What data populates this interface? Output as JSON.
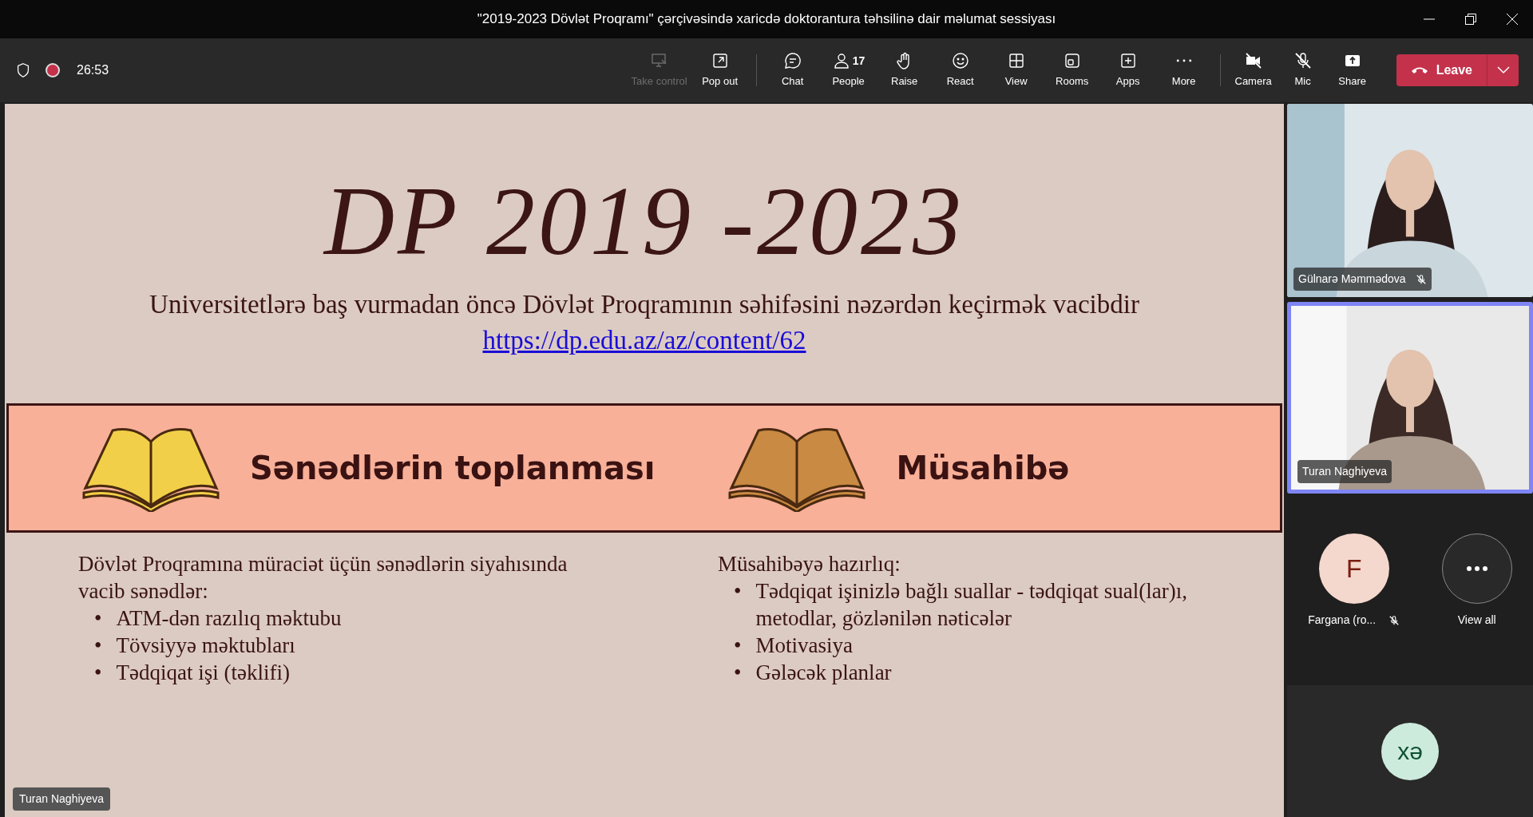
{
  "window": {
    "title": "\"2019-2023 Dövlət Proqramı\" çərçivəsində xaricdə doktorantura təhsilinə dair məlumat sessiyası"
  },
  "toolbar": {
    "recording": true,
    "timer": "26:53",
    "buttons": [
      {
        "label": "Take control",
        "disabled": true
      },
      {
        "label": "Pop out",
        "disabled": false
      },
      {
        "label": "Chat",
        "disabled": false
      },
      {
        "label": "People",
        "disabled": false,
        "count": "17"
      },
      {
        "label": "Raise",
        "disabled": false
      },
      {
        "label": "React",
        "disabled": false
      },
      {
        "label": "View",
        "disabled": false
      },
      {
        "label": "Rooms",
        "disabled": false
      },
      {
        "label": "Apps",
        "disabled": false
      },
      {
        "label": "More",
        "disabled": false
      }
    ],
    "devices": [
      {
        "label": "Camera",
        "on": false
      },
      {
        "label": "Mic",
        "on": false
      },
      {
        "label": "Share",
        "on": true
      }
    ],
    "leave": {
      "label": "Leave"
    }
  },
  "slide": {
    "title": "DP 2019 -2023",
    "subtitle": "Universitetlərə baş vurmadan öncə Dövlət Proqramının səhifəsini nəzərdən keçirmək vacibdir",
    "link": "https://dp.edu.az/az/content/62",
    "sections": [
      {
        "heading": "Sənədlərin toplanması",
        "marker": "•",
        "intro": "Dövlət Proqramına müraciət üçün sənədlərin siyahısında vacib sənədlər:",
        "bullets": [
          "ATM-dən razılıq məktubu",
          "Tövsiyyə məktubları",
          "Tədqiqat işi (təklifi)"
        ]
      },
      {
        "heading": "Müsahibə",
        "marker": "•",
        "intro": "Müsahibəyə hazırlıq:",
        "bullets": [
          "Tədqiqat işinizlə bağlı suallar - tədqiqat sual(lar)ı, metodlar, gözlənilən nəticələr",
          "Motivasiya",
          "Gələcək planlar"
        ]
      }
    ],
    "presenter": "Turan Naghiyeva"
  },
  "participants": {
    "videos": [
      {
        "name": "Gülnarə Məmmədova",
        "muted": true,
        "selected": false
      },
      {
        "name": "Turan Naghiyeva",
        "muted": false,
        "selected": true
      }
    ],
    "avatars": [
      {
        "kind": "person",
        "initial": "F",
        "name": "Fargana (ro...",
        "muted": true
      },
      {
        "kind": "more",
        "name": "View all",
        "muted": false
      }
    ],
    "bottom_tile": {
      "initials": "xə"
    }
  }
}
